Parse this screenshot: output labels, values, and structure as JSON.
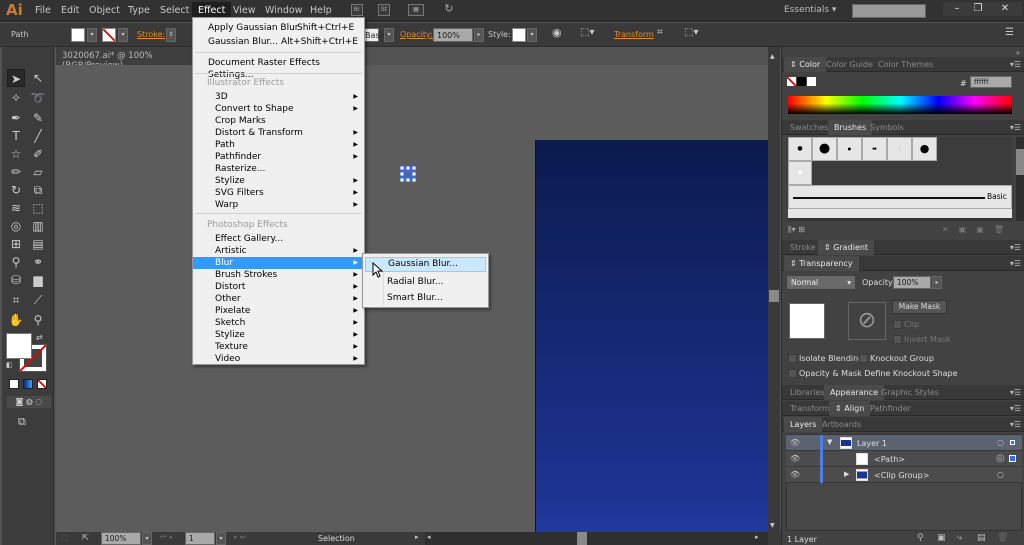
{
  "app": {
    "logo": "Ai"
  },
  "menubar": {
    "items": [
      "File",
      "Edit",
      "Object",
      "Type",
      "Select",
      "Effect",
      "View",
      "Window",
      "Help"
    ],
    "workspace": "Essentials",
    "search_placeholder": ""
  },
  "window_controls": {
    "minimize": "–",
    "restore": "❐",
    "close": "✕"
  },
  "control_bar": {
    "selection": "Path",
    "stroke_label": "Stroke:",
    "brush": "Basic",
    "opacity_label": "Opacity:",
    "opacity_value": "100%",
    "style_label": "Style:",
    "transform_label": "Transform"
  },
  "document": {
    "tab_title": "3020067.ai* @ 100% (RGB/Preview)"
  },
  "effect_menu": {
    "recent": [
      {
        "label": "Apply Gaussian Blur",
        "shortcut": "Shift+Ctrl+E"
      },
      {
        "label": "Gaussian Blur...",
        "shortcut": "Alt+Shift+Ctrl+E"
      }
    ],
    "doc_raster": "Document Raster Effects Settings...",
    "illustrator_header": "Illustrator Effects",
    "illustrator_items": [
      {
        "label": "3D",
        "sub": true
      },
      {
        "label": "Convert to Shape",
        "sub": true
      },
      {
        "label": "Crop Marks",
        "sub": false
      },
      {
        "label": "Distort & Transform",
        "sub": true
      },
      {
        "label": "Path",
        "sub": true
      },
      {
        "label": "Pathfinder",
        "sub": true
      },
      {
        "label": "Rasterize...",
        "sub": false
      },
      {
        "label": "Stylize",
        "sub": true
      },
      {
        "label": "SVG Filters",
        "sub": true
      },
      {
        "label": "Warp",
        "sub": true
      }
    ],
    "photoshop_header": "Photoshop Effects",
    "photoshop_items": [
      {
        "label": "Effect Gallery...",
        "sub": false
      },
      {
        "label": "Artistic",
        "sub": true
      },
      {
        "label": "Blur",
        "sub": true,
        "highlighted": true
      },
      {
        "label": "Brush Strokes",
        "sub": true
      },
      {
        "label": "Distort",
        "sub": true
      },
      {
        "label": "Other",
        "sub": true
      },
      {
        "label": "Pixelate",
        "sub": true
      },
      {
        "label": "Sketch",
        "sub": true
      },
      {
        "label": "Stylize",
        "sub": true
      },
      {
        "label": "Texture",
        "sub": true
      },
      {
        "label": "Video",
        "sub": true
      }
    ]
  },
  "blur_submenu": {
    "items": [
      "Gaussian Blur...",
      "Radial Blur...",
      "Smart Blur..."
    ],
    "hovered": "Gaussian Blur..."
  },
  "panels": {
    "color": {
      "tabs": [
        "Color",
        "Color Guide",
        "Color Themes"
      ],
      "hex_label": "#",
      "hex_value": "ffffff"
    },
    "brushes": {
      "tabs": [
        "Swatches",
        "Brushes",
        "Symbols"
      ],
      "stroke_name": "Basic"
    },
    "stroke_gradient": {
      "tabs": [
        "Stroke",
        "Gradient"
      ]
    },
    "transparency": {
      "tab": "Transparency",
      "blend_mode": "Normal",
      "opacity_label": "Opacity:",
      "opacity_value": "100%",
      "make_mask": "Make Mask",
      "clip": "Clip",
      "invert_mask": "Invert Mask",
      "isolate_blending": "Isolate Blending",
      "knockout_group": "Knockout Group",
      "opacity_mask_knockout": "Opacity & Mask Define Knockout Shape"
    },
    "appearance": {
      "tabs": [
        "Libraries",
        "Appearance",
        "Graphic Styles"
      ]
    },
    "align": {
      "tabs": [
        "Transform",
        "Align",
        "Pathfinder"
      ]
    },
    "layers": {
      "tabs": [
        "Layers",
        "Artboards"
      ],
      "rows": [
        {
          "name": "Layer 1"
        },
        {
          "name": "<Path>"
        },
        {
          "name": "<Clip Group>"
        }
      ],
      "footer": "1 Layer"
    }
  },
  "status_bar": {
    "zoom": "100%",
    "page": "1",
    "tool": "Selection"
  },
  "colors": {
    "accent_orange": "#e08a2a",
    "highlight": "#3399ff",
    "artboard_blue": "#1d3391"
  }
}
